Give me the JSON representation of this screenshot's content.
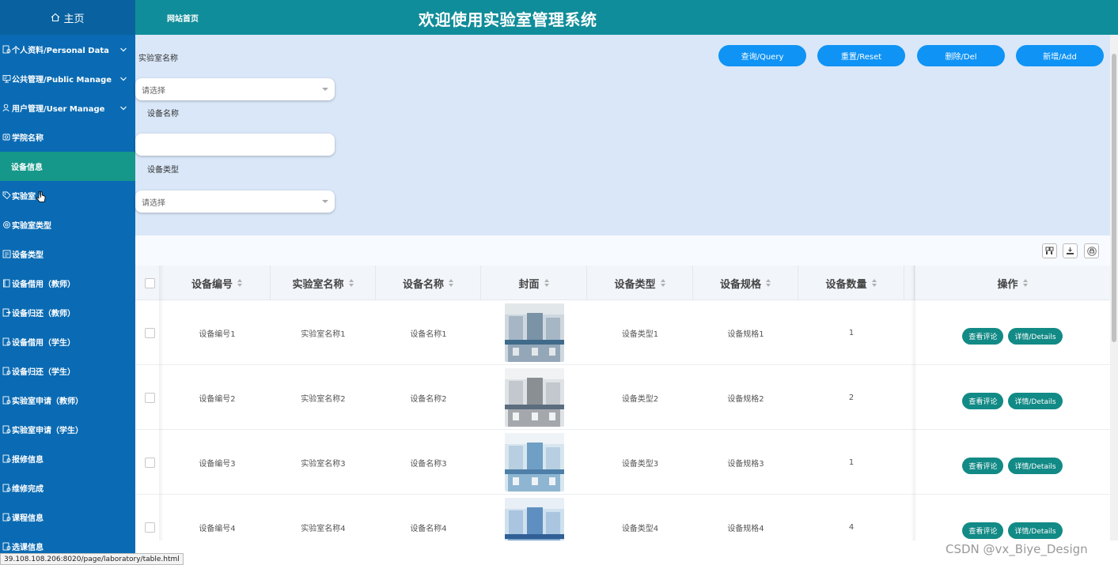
{
  "sidebar": {
    "home_label": "主页",
    "items": [
      {
        "label": "个人资料/Personal Data",
        "icon": "user-doc-icon",
        "expandable": true
      },
      {
        "label": "公共管理/Public Manage",
        "icon": "monitor-icon",
        "expandable": true
      },
      {
        "label": "用户管理/User Manage",
        "icon": "user-icon",
        "expandable": true
      },
      {
        "label": "学院名称",
        "icon": "doc-icon",
        "expandable": false
      },
      {
        "label": "设备信息",
        "icon": "",
        "expandable": false,
        "active": true
      },
      {
        "label": "实验室",
        "icon": "tag-icon",
        "expandable": false
      },
      {
        "label": "实验室类型",
        "icon": "gear-icon",
        "expandable": false
      },
      {
        "label": "设备类型",
        "icon": "list-icon",
        "expandable": false
      },
      {
        "label": "设备借用（教师）",
        "icon": "book-icon",
        "expandable": false
      },
      {
        "label": "设备归还（教师）",
        "icon": "return-icon",
        "expandable": false
      },
      {
        "label": "设备借用（学生）",
        "icon": "user-doc-icon",
        "expandable": false
      },
      {
        "label": "设备归还（学生）",
        "icon": "user-doc-icon",
        "expandable": false
      },
      {
        "label": "实验室申请（教师）",
        "icon": "user-doc-icon",
        "expandable": false
      },
      {
        "label": "实验室申请（学生）",
        "icon": "user-doc-icon",
        "expandable": false
      },
      {
        "label": "报修信息",
        "icon": "user-doc-icon",
        "expandable": false
      },
      {
        "label": "维修完成",
        "icon": "user-doc-icon",
        "expandable": false
      },
      {
        "label": "课程信息",
        "icon": "user-doc-icon",
        "expandable": false
      },
      {
        "label": "选课信息",
        "icon": "user-doc-icon",
        "expandable": false
      }
    ]
  },
  "header": {
    "nav_link": "网站首页",
    "title": "欢迎使用实验室管理系统"
  },
  "search": {
    "lab_name_label": "实验室名称",
    "lab_name_placeholder": "请选择",
    "device_name_label": "设备名称",
    "device_name_value": "",
    "device_type_label": "设备类型",
    "device_type_placeholder": "请选择",
    "buttons": {
      "query": "查询/Query",
      "reset": "重置/Reset",
      "delete": "删除/Del",
      "add": "新增/Add"
    }
  },
  "table": {
    "columns": [
      "设备编号",
      "实验室名称",
      "设备名称",
      "封面",
      "设备类型",
      "设备规格",
      "设备数量",
      "操作"
    ],
    "rows": [
      {
        "code": "设备编号1",
        "lab": "实验室名称1",
        "name": "设备名称1",
        "type": "设备类型1",
        "spec": "设备规格1",
        "qty": "1"
      },
      {
        "code": "设备编号2",
        "lab": "实验室名称2",
        "name": "设备名称2",
        "type": "设备类型2",
        "spec": "设备规格2",
        "qty": "2"
      },
      {
        "code": "设备编号3",
        "lab": "实验室名称3",
        "name": "设备名称3",
        "type": "设备类型3",
        "spec": "设备规格3",
        "qty": "1"
      },
      {
        "code": "设备编号4",
        "lab": "实验室名称4",
        "name": "设备名称4",
        "type": "设备类型4",
        "spec": "设备规格4",
        "qty": "4"
      }
    ],
    "actions": {
      "review": "查看评论",
      "details": "详情/Details"
    }
  },
  "statusbar": {
    "url": "39.108.108.206:8020/page/laboratory/table.html"
  },
  "watermark": "CSDN @vx_Biye_Design",
  "colors": {
    "sidebar": "#0a6bb4",
    "sidebar_active": "#15988a",
    "header": "#108d9a",
    "search_bg": "#d9e7f8",
    "primary_button": "#0f93f5",
    "row_button": "#128a86"
  }
}
